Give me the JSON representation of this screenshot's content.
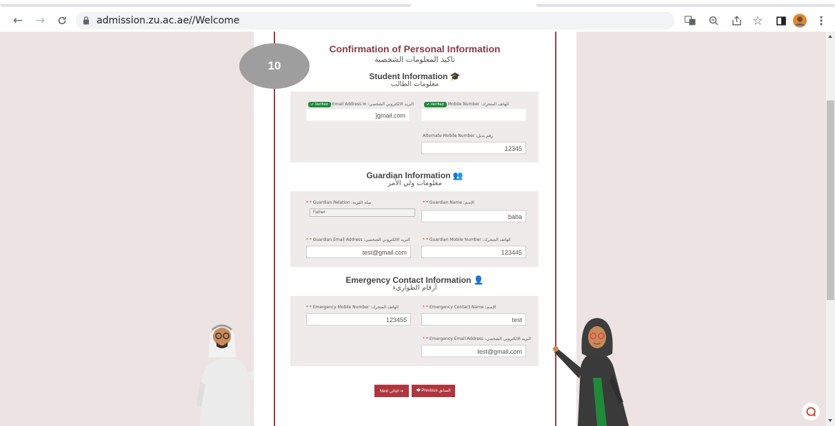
{
  "browser": {
    "url": "admission.zu.ac.ae//Welcome",
    "nav": {
      "back": "←",
      "forward": "→",
      "reload": "C"
    },
    "toolbar_icons": [
      "translate-icon",
      "zoom-icon",
      "share-icon",
      "bookmark-star-icon",
      "side-panel-icon",
      "profile-avatar",
      "menu-dots-icon"
    ]
  },
  "overlay": {
    "step_number": "10"
  },
  "page": {
    "title_en": "Confirmation of Personal Information",
    "title_ar": "تاكيد المعلومات الشخصية"
  },
  "student": {
    "heading_en": "Student Information",
    "heading_ar": "معلومات الطالب",
    "email_label": "Email Address ✉ :البريد الالكتروني الشخصي",
    "email_verified": "✔ Verified",
    "email_value": "]gmail.com",
    "mobile_label": "Mobile Number :الهاتف المتحرك",
    "mobile_verified": "✔ Verified",
    "mobile_value": "",
    "alt_mobile_label": "Alternate Mobile Number :رقم بديل",
    "alt_mobile_value": "12345"
  },
  "guardian": {
    "heading_en": "Guardian Information",
    "heading_ar": "معلومات ولي الأمر",
    "relation_label": "Guardian Relation :صلة القربة",
    "relation_value": "Father",
    "name_label": "Guardian Name :الإسم",
    "name_value": "baba",
    "email_label": "Guardian Email Address :البريد الالكتروني الشخصي",
    "email_value": "test@gmail.com",
    "mobile_label": "Guardian Mobile Number :الهاتف المتحرك",
    "mobile_value": "123445"
  },
  "emergency": {
    "heading_en": "Emergency Contact Information",
    "heading_ar": "أرقام الطوارىء",
    "mobile_label": "Emergency Mobile Number :الهاتف المتحرك",
    "mobile_value": "123455",
    "name_label": "Emergency Contact Name :الإسم",
    "name_value": "test",
    "email_label": "Emergency Email Address :البريد الالكتروني الشخصي",
    "email_value": "test@gmail.com"
  },
  "required_mark": "* *",
  "buttons": {
    "next": "Next التالي ➔",
    "previous": "🡄 Previous السابق"
  },
  "colors": {
    "accent": "#b0353f",
    "title": "#8b3a45",
    "background": "#ede3e2",
    "verified": "#1f8a3a"
  }
}
